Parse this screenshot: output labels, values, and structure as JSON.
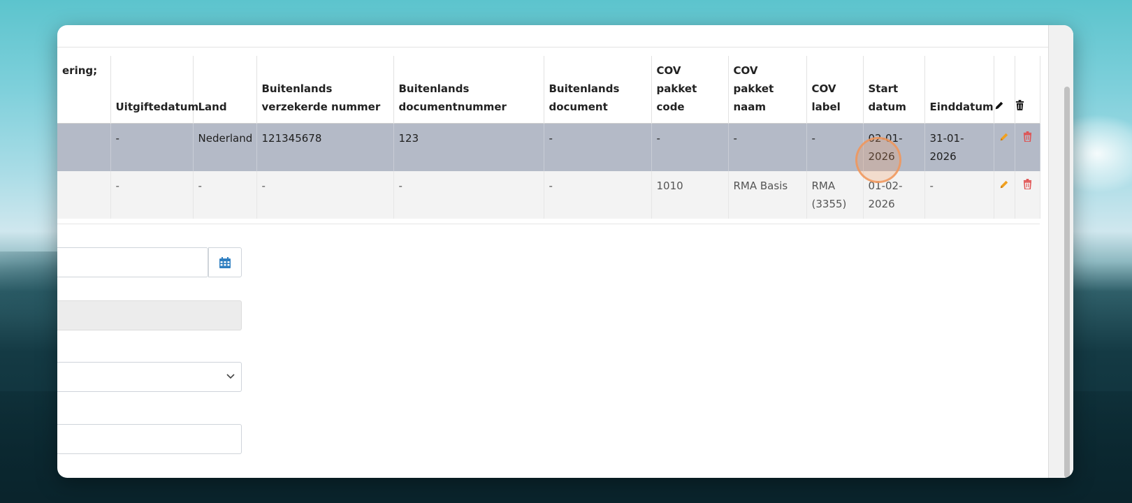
{
  "table": {
    "headers": [
      {
        "key": "partial",
        "label": "ering;"
      },
      {
        "key": "uitgifte",
        "label": "Uitgiftedatum"
      },
      {
        "key": "land",
        "label": "Land"
      },
      {
        "key": "bvn",
        "label": "Buitenlands verzekerde nummer"
      },
      {
        "key": "bdn",
        "label": "Buitenlands documentnummer"
      },
      {
        "key": "bd",
        "label": "Buitenlands document"
      },
      {
        "key": "covcode",
        "label": "COV pakket code"
      },
      {
        "key": "covnaam",
        "label": "COV pakket naam"
      },
      {
        "key": "covlabel",
        "label": "COV label"
      },
      {
        "key": "start",
        "label": "Start datum"
      },
      {
        "key": "eind",
        "label": "Einddatum"
      }
    ],
    "rows": [
      {
        "partial": "",
        "uitgifte": "-",
        "land": "Nederland",
        "bvn": "121345678",
        "bdn": "123",
        "bd": "-",
        "covcode": "-",
        "covnaam": "-",
        "covlabel": "-",
        "start": "02-01-2026",
        "eind": "31-01-2026"
      },
      {
        "partial": "",
        "uitgifte": "-",
        "land": "-",
        "bvn": "-",
        "bdn": "-",
        "bd": "-",
        "covcode": "1010",
        "covnaam": "RMA Basis",
        "covlabel": "RMA (3355)",
        "start": "01-02-2026",
        "eind": "-"
      }
    ]
  },
  "icons": {
    "edit": "pencil-icon",
    "delete": "trash-icon",
    "calendar": "calendar-icon",
    "dropdown": "chevron-down-icon"
  },
  "colors": {
    "selected_row": "#b4bac7",
    "alt_row": "#f3f3f3",
    "edit_icon": "#f0a020",
    "delete_icon": "#e05050",
    "calendar_icon": "#2f7fc1"
  }
}
